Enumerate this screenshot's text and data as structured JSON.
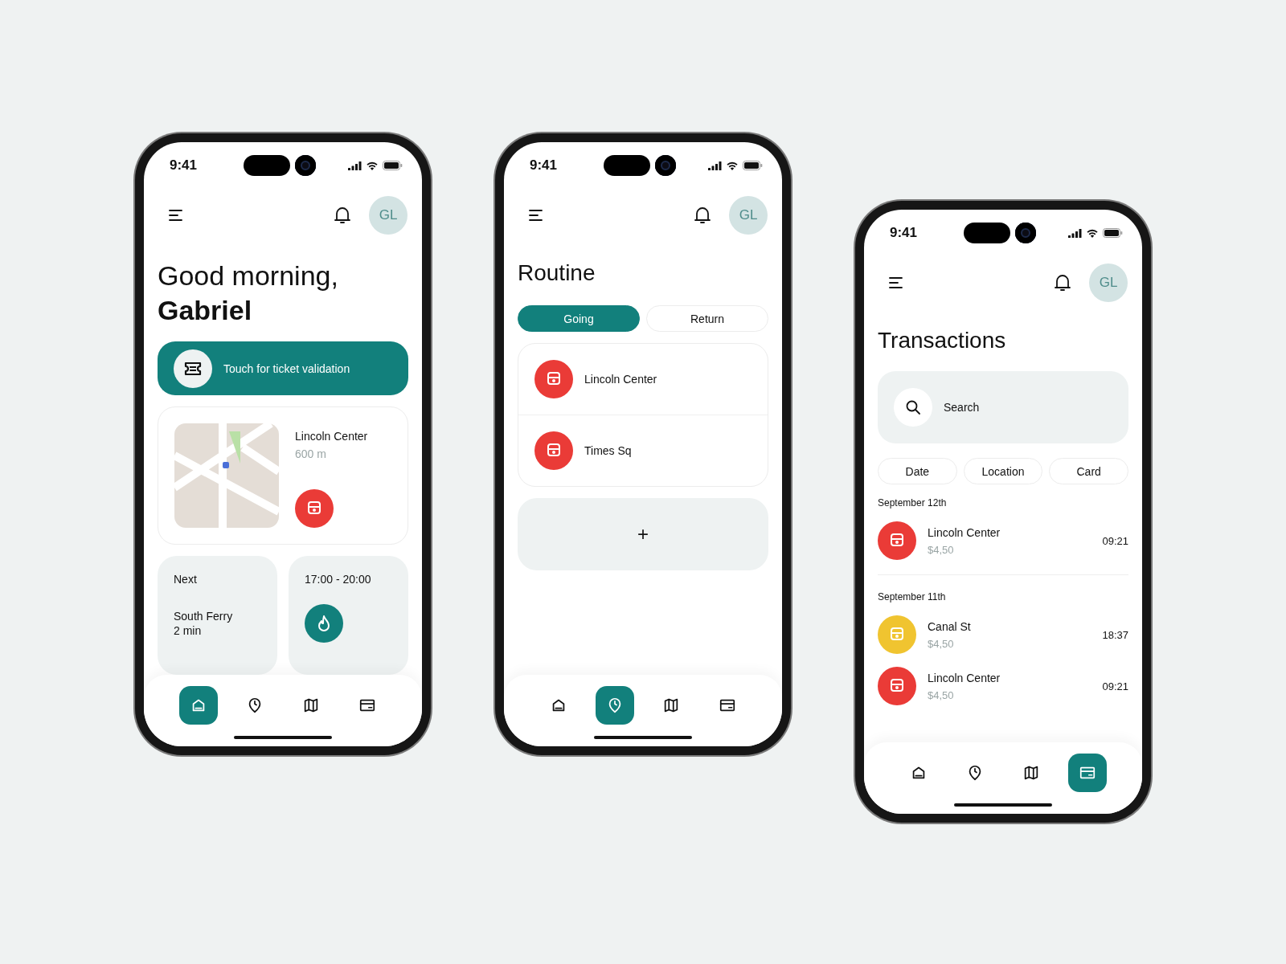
{
  "phones": [
    {
      "kind": "home",
      "time": "9:41",
      "avatar": "GL",
      "greeting": "Good morning,",
      "name": "Gabriel",
      "validation": "Touch for ticket validation",
      "nearby": {
        "station": "Lincoln Center",
        "distance": "600 m"
      },
      "next": {
        "label": "Next",
        "station": "South Ferry",
        "eta": "2 min"
      },
      "schedule": {
        "hours": "17:00 - 20:00"
      },
      "nav": [
        {
          "kind": "home",
          "selected": true
        },
        {
          "kind": "history",
          "selected": false
        },
        {
          "kind": "map",
          "selected": false
        },
        {
          "kind": "card",
          "selected": false
        }
      ]
    },
    {
      "kind": "routine",
      "time": "9:41",
      "avatar": "GL",
      "title": "Routine",
      "tabs": [
        {
          "label": "Going",
          "selected": true
        },
        {
          "label": "Return",
          "selected": false
        }
      ],
      "stops": [
        {
          "name": "Lincoln Center"
        },
        {
          "name": "Times Sq"
        }
      ],
      "add": "+",
      "nav": [
        {
          "kind": "home",
          "selected": false
        },
        {
          "kind": "history",
          "selected": true
        },
        {
          "kind": "map",
          "selected": false
        },
        {
          "kind": "card",
          "selected": false
        }
      ]
    },
    {
      "kind": "transactions",
      "time": "9:41",
      "avatar": "GL",
      "title": "Transactions",
      "search": {
        "placeholder": "Search"
      },
      "filters": [
        "Date",
        "Location",
        "Card"
      ],
      "groups": [
        {
          "date": "September 12th",
          "items": [
            {
              "station": "Lincoln Center",
              "amount": "$4,50",
              "time": "09:21",
              "color": "#ea3b37"
            }
          ]
        },
        {
          "date": "September 11th",
          "items": [
            {
              "station": "Canal St",
              "amount": "$4,50",
              "time": "18:37",
              "color": "#f0c430"
            },
            {
              "station": "Lincoln Center",
              "amount": "$4,50",
              "time": "09:21",
              "color": "#ea3b37"
            }
          ]
        }
      ],
      "nav": [
        {
          "kind": "home",
          "selected": false
        },
        {
          "kind": "history",
          "selected": false
        },
        {
          "kind": "map",
          "selected": false
        },
        {
          "kind": "card",
          "selected": true
        }
      ]
    }
  ]
}
